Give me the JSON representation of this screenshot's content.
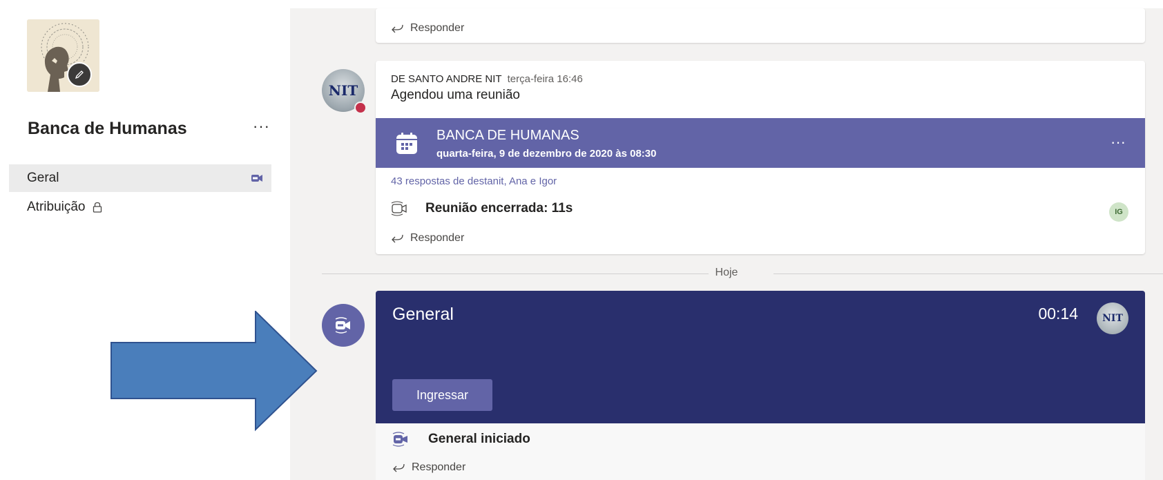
{
  "team": {
    "name": "Banca de Humanas",
    "more_label": "···"
  },
  "channels": [
    {
      "label": "Geral",
      "active": true,
      "has_meeting": true
    },
    {
      "label": "Atribuição",
      "active": false,
      "locked": true
    }
  ],
  "feed": {
    "reply_label": "Responder",
    "post": {
      "author": "DE SANTO ANDRE NIT",
      "time": "terça-feira 16:46",
      "text": "Agendou uma reunião",
      "meeting": {
        "title": "BANCA DE HUMANAS",
        "date": "quarta-feira, 9 de dezembro de 2020 às 08:30",
        "more_label": "···"
      },
      "replies_link": "43 respostas de destanit, Ana e Igor",
      "ended_text": "Reunião encerrada: 11s",
      "participant_initials": "IG"
    },
    "date_divider": "Hoje",
    "live_meeting": {
      "title": "General",
      "timer": "00:14",
      "join_label": "Ingressar",
      "started_text": "General iniciado"
    },
    "avatar_text": "NIT"
  },
  "colors": {
    "accent": "#6264a7",
    "banner_dark": "#292f6d",
    "arrow_fill": "#4a7ebb",
    "arrow_stroke": "#2f528f",
    "status_busy": "#c4314b"
  }
}
